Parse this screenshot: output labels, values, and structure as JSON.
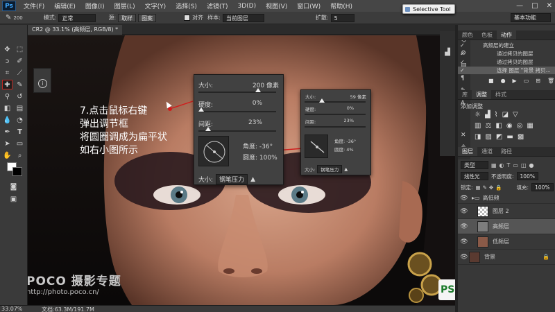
{
  "app": {
    "logo": "Ps",
    "menu": [
      "文件(F)",
      "编辑(E)",
      "图像(I)",
      "图层(L)",
      "文字(Y)",
      "选择(S)",
      "滤镜(T)",
      "3D(D)",
      "视图(V)",
      "窗口(W)",
      "帮助(H)"
    ],
    "window_controls": [
      "—",
      "□",
      "✕"
    ]
  },
  "options_bar": {
    "brush_size": "200",
    "mode_label": "模式:",
    "mode_value": "正常",
    "source_label": "源:",
    "sampled_btn": "取样",
    "pattern_btn": "图案",
    "aligned_label": "对齐",
    "sample_label": "样本:",
    "sample_value": "当前图层",
    "diffusion_label": "扩散:",
    "diffusion_value": "5",
    "workspace": "基本功能"
  },
  "selective_tool": "Selective Tool",
  "document_tab": "CR2 @ 33.1% (高频层, RGB/8) *",
  "status": {
    "zoom": "33.07%",
    "doc": "文档:63.3M/191.7M"
  },
  "caption": {
    "lines": [
      "7.点击鼠标右键",
      "弹出调节框",
      "将圆圈调成为扁平状",
      "如右小图所示"
    ]
  },
  "brush_panel_large": {
    "size_label": "大小:",
    "size_value": "200 像素",
    "hardness_label": "硬度:",
    "hardness_value": "0%",
    "spacing_label": "间距:",
    "spacing_value": "23%",
    "angle_label": "角度:",
    "angle_value": "-36°",
    "roundness_label": "圆度:",
    "roundness_value": "100%",
    "bottom_size_label": "大小:",
    "pressure_value": "钢笔压力"
  },
  "brush_panel_small": {
    "size_label": "大小:",
    "size_value": "59 像素",
    "hardness_label": "硬度:",
    "hardness_value": "0%",
    "spacing_label": "间距:",
    "spacing_value": "23%",
    "angle_label": "角度:",
    "angle_value": "-36°",
    "roundness_label": "圆度:",
    "roundness_value": "4%",
    "bottom_size_label": "大小:",
    "pressure_value": "钢笔压力"
  },
  "watermarks": {
    "poco_brand": "POCO 摄影专题",
    "poco_url": "http://photo.poco.cn/",
    "ps_site": "PS 爱好者"
  },
  "right_panel": {
    "top_tabs": [
      "颜色",
      "色板",
      "动作"
    ],
    "actions": [
      "高频层的建立",
      "通过拷贝的图层",
      "通过拷贝的图层",
      "选择 图层 \"背景 拷贝..."
    ],
    "mid_tabs": [
      "库",
      "调整",
      "样式"
    ],
    "adjust_title": "添加调整",
    "layer_tabs": [
      "图层",
      "通道",
      "路径"
    ],
    "kind_label": "类型",
    "blend_mode": "线性光",
    "opacity_label": "不透明度:",
    "opacity_value": "100%",
    "lock_label": "锁定:",
    "fill_label": "填充:",
    "fill_value": "100%",
    "layers": [
      {
        "name": "高低频"
      },
      {
        "name": "图层 2"
      },
      {
        "name": "高频层"
      },
      {
        "name": "低频层"
      },
      {
        "name": "背景"
      }
    ]
  },
  "colors": {
    "accent_red": "#c2261f",
    "panel": "#383838",
    "menubar": "#464646"
  }
}
